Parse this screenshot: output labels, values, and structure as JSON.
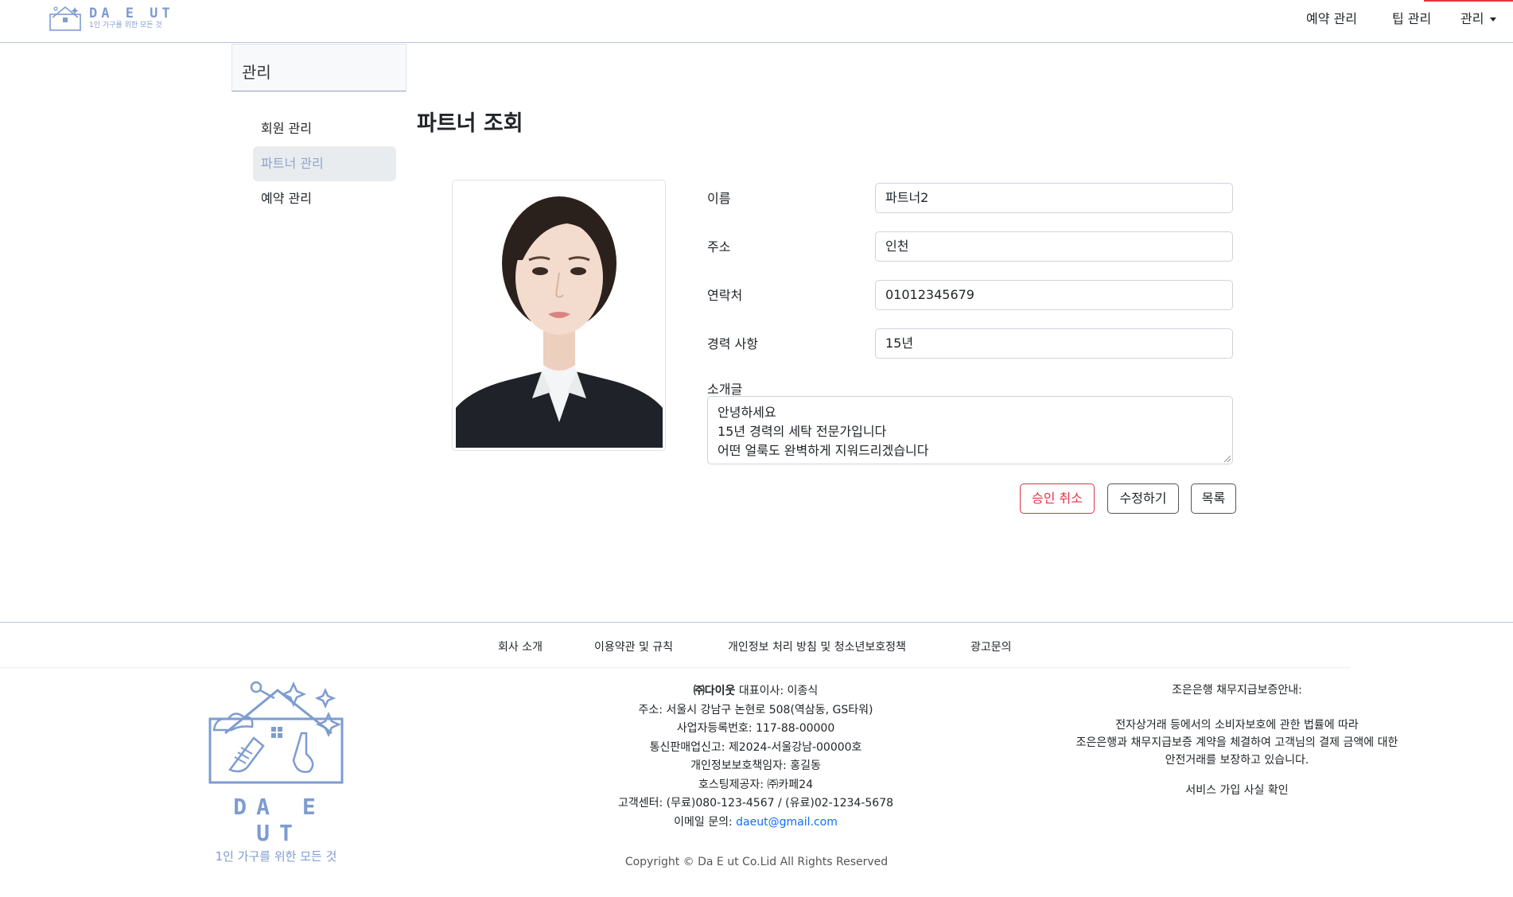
{
  "header": {
    "logo_text": "DA E UT",
    "logo_tagline": "1인 가구를 위한 모든 것",
    "nav": [
      "예약 관리",
      "팁 관리",
      "관리"
    ],
    "accent_color": "#e2343a"
  },
  "sidebar": {
    "title": "관리",
    "items": [
      {
        "label": "회원 관리",
        "active": false
      },
      {
        "label": "파트너 관리",
        "active": true
      },
      {
        "label": "예약 관리",
        "active": false
      }
    ]
  },
  "main": {
    "title": "파트너 조회",
    "photo_icon": "partner-photo",
    "fields": [
      {
        "label": "이름",
        "value": "파트너2"
      },
      {
        "label": "주소",
        "value": "인천"
      },
      {
        "label": "연락처",
        "value": "01012345679"
      },
      {
        "label": "경력 사항",
        "value": "15년"
      }
    ],
    "intro_label": "소개글",
    "intro_lines": [
      "안녕하세요",
      "15년 경력의 세탁 전문가입니다",
      "어떤 얼룩도 완벽하게 지워드리겠습니다"
    ],
    "buttons": {
      "cancel_approval": "승인 취소",
      "edit": "수정하기",
      "list": "목록"
    },
    "danger_color": "#dc3545"
  },
  "footer": {
    "links": [
      "회사 소개",
      "이용약관 및 규칙",
      "개인정보 처리 방침 및 청소년보호정책",
      "광고문의"
    ],
    "logo_text": "DA E UT",
    "logo_tagline": "1인 가구를 위한 모든 것",
    "company": {
      "name": "㈜다이웃",
      "ceo": "대표이사: 이종식",
      "address": "주소: 서울시 강남구 논현로 508(역삼동, GS타워)",
      "biz_no": "사업자등록번호: 117-88-00000",
      "ecommerce_no": "통신판매업신고: 제2024-서울강남-00000호",
      "privacy_officer": "개인정보보호책임자: 홍길동",
      "hosting": "호스팅제공자: ㈜카페24",
      "cs_center": "고객센터: (무료)080-123-4567 / (유료)02-1234-5678",
      "email_label": "이메일 문의:",
      "email": "daeut@gmail.com"
    },
    "bank": {
      "title": "조은은행 채무지급보증안내:",
      "line1": "전자상거래 등에서의 소비자보호에 관한 법률에 따라",
      "line2": "조은은행과 채무지급보증 계약을 체결하여 고객님의 결제 금액에 대한",
      "line3": "안전거래를 보장하고 있습니다.",
      "confirm": "서비스 가입 사실 확인"
    },
    "copyright": "Copyright © Da E ut Co.Lid All Rights Reserved"
  }
}
